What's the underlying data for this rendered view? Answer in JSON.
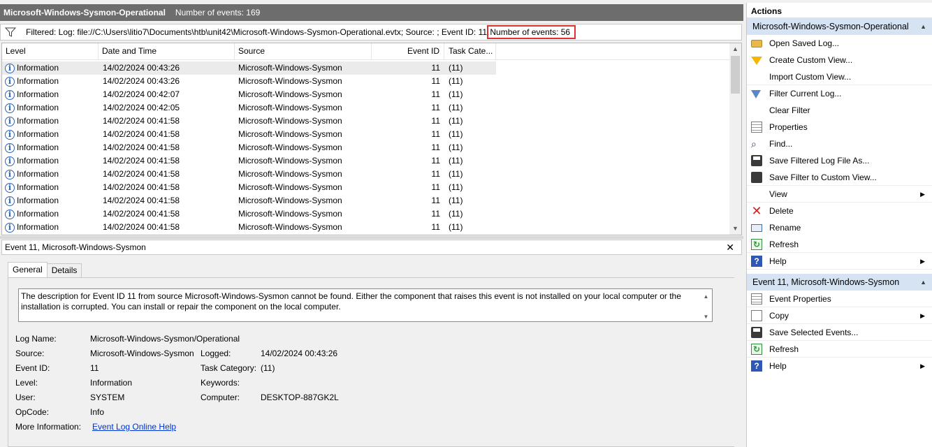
{
  "log_header": {
    "title": "Microsoft-Windows-Sysmon-Operational",
    "count": "Number of events: 169"
  },
  "filter_bar": {
    "text": "Filtered: Log: file://C:\\Users\\litio7\\Documents\\htb\\unit42\\Microsoft-Windows-Sysmon-Operational.evtx; Source: ; Event ID: 11.",
    "highlighted": "Number of events: 56",
    "highlight_color": "#e03030"
  },
  "grid": {
    "columns": [
      "Level",
      "Date and Time",
      "Source",
      "Event ID",
      "Task Cate..."
    ],
    "rows": [
      {
        "level": "Information",
        "date": "14/02/2024 00:43:26",
        "source": "Microsoft-Windows-Sysmon",
        "id": "11",
        "task": "(11)"
      },
      {
        "level": "Information",
        "date": "14/02/2024 00:43:26",
        "source": "Microsoft-Windows-Sysmon",
        "id": "11",
        "task": "(11)"
      },
      {
        "level": "Information",
        "date": "14/02/2024 00:42:07",
        "source": "Microsoft-Windows-Sysmon",
        "id": "11",
        "task": "(11)"
      },
      {
        "level": "Information",
        "date": "14/02/2024 00:42:05",
        "source": "Microsoft-Windows-Sysmon",
        "id": "11",
        "task": "(11)"
      },
      {
        "level": "Information",
        "date": "14/02/2024 00:41:58",
        "source": "Microsoft-Windows-Sysmon",
        "id": "11",
        "task": "(11)"
      },
      {
        "level": "Information",
        "date": "14/02/2024 00:41:58",
        "source": "Microsoft-Windows-Sysmon",
        "id": "11",
        "task": "(11)"
      },
      {
        "level": "Information",
        "date": "14/02/2024 00:41:58",
        "source": "Microsoft-Windows-Sysmon",
        "id": "11",
        "task": "(11)"
      },
      {
        "level": "Information",
        "date": "14/02/2024 00:41:58",
        "source": "Microsoft-Windows-Sysmon",
        "id": "11",
        "task": "(11)"
      },
      {
        "level": "Information",
        "date": "14/02/2024 00:41:58",
        "source": "Microsoft-Windows-Sysmon",
        "id": "11",
        "task": "(11)"
      },
      {
        "level": "Information",
        "date": "14/02/2024 00:41:58",
        "source": "Microsoft-Windows-Sysmon",
        "id": "11",
        "task": "(11)"
      },
      {
        "level": "Information",
        "date": "14/02/2024 00:41:58",
        "source": "Microsoft-Windows-Sysmon",
        "id": "11",
        "task": "(11)"
      },
      {
        "level": "Information",
        "date": "14/02/2024 00:41:58",
        "source": "Microsoft-Windows-Sysmon",
        "id": "11",
        "task": "(11)"
      },
      {
        "level": "Information",
        "date": "14/02/2024 00:41:58",
        "source": "Microsoft-Windows-Sysmon",
        "id": "11",
        "task": "(11)"
      }
    ]
  },
  "details": {
    "title": "Event 11, Microsoft-Windows-Sysmon",
    "close": "✕",
    "tabs": [
      "General",
      "Details"
    ],
    "description": "The description for Event ID 11 from source Microsoft-Windows-Sysmon cannot be found. Either the component that raises this event is not installed on your local computer or the installation is corrupted. You can install or repair the component on the local computer.",
    "fields": {
      "log_name_label": "Log Name:",
      "log_name": "Microsoft-Windows-Sysmon/Operational",
      "source_label": "Source:",
      "source": "Microsoft-Windows-Sysmon",
      "logged_label": "Logged:",
      "logged": "14/02/2024 00:43:26",
      "event_id_label": "Event ID:",
      "event_id": "11",
      "task_label": "Task Category:",
      "task": "(11)",
      "level_label": "Level:",
      "level": "Information",
      "keywords_label": "Keywords:",
      "keywords": "",
      "user_label": "User:",
      "user": "SYSTEM",
      "computer_label": "Computer:",
      "computer": "DESKTOP-887GK2L",
      "opcode_label": "OpCode:",
      "opcode": "Info",
      "more_info_label": "More Information:",
      "more_info_link": "Event Log Online Help"
    }
  },
  "actions": {
    "title": "Actions",
    "section1": {
      "title": "Microsoft-Windows-Sysmon-Operational",
      "items": [
        {
          "label": "Open Saved Log...",
          "icon": "folder-icon"
        },
        {
          "label": "Create Custom View...",
          "icon": "funnel-color-icon"
        },
        {
          "label": "Import Custom View...",
          "icon": ""
        },
        {
          "label": "Filter Current Log...",
          "icon": "funnel-blue-icon"
        },
        {
          "label": "Clear Filter",
          "icon": ""
        },
        {
          "label": "Properties",
          "icon": "properties-icon"
        },
        {
          "label": "Find...",
          "icon": "binoculars-icon"
        },
        {
          "label": "Save Filtered Log File As...",
          "icon": "save-icon"
        },
        {
          "label": "Save Filter to Custom View...",
          "icon": "save-filter-icon"
        },
        {
          "label": "View",
          "icon": ""
        },
        {
          "label": "Delete",
          "icon": "delete-icon"
        },
        {
          "label": "Rename",
          "icon": "rename-icon"
        },
        {
          "label": "Refresh",
          "icon": "refresh-icon"
        },
        {
          "label": "Help",
          "icon": "help-icon"
        }
      ]
    },
    "section2": {
      "title": "Event 11, Microsoft-Windows-Sysmon",
      "items": [
        {
          "label": "Event Properties",
          "icon": "properties-icon"
        },
        {
          "label": "Copy",
          "icon": "copy-icon"
        },
        {
          "label": "Save Selected Events...",
          "icon": "save-icon"
        },
        {
          "label": "Refresh",
          "icon": "refresh-icon"
        },
        {
          "label": "Help",
          "icon": "help-icon"
        }
      ]
    }
  }
}
